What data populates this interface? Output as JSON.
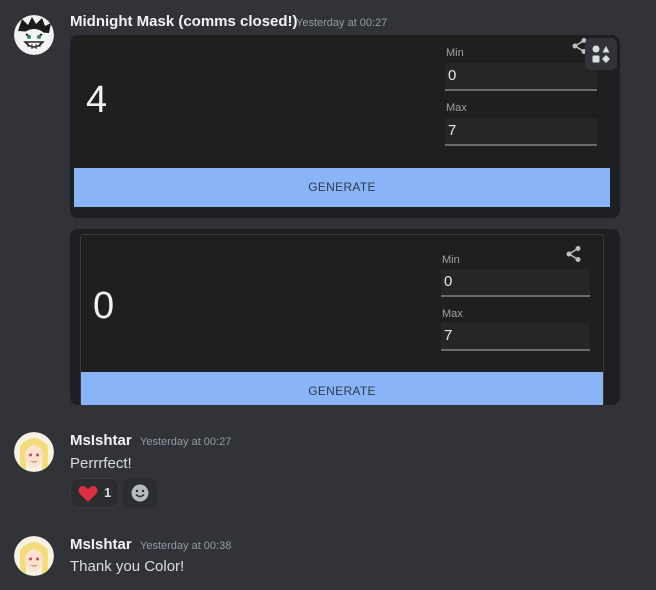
{
  "messages": [
    {
      "username": "Midnight Mask (comms closed!)",
      "timestamp": "Yesterday at 00:27",
      "avatar": "grinning-character-avatar",
      "embeds": [
        {
          "number": "4",
          "min_label": "Min",
          "min_value": "0",
          "max_label": "Max",
          "max_value": "7",
          "button_label": "GENERATE"
        },
        {
          "number": "0",
          "min_label": "Min",
          "min_value": "0",
          "max_label": "Max",
          "max_value": "7",
          "button_label": "GENERATE"
        }
      ]
    },
    {
      "username": "MsIshtar",
      "timestamp": "Yesterday at 00:27",
      "avatar": "blonde-character-avatar",
      "text": "Perrrfect!",
      "reactions": [
        {
          "emoji": "heart-icon",
          "count": "1"
        }
      ]
    },
    {
      "username": "MsIshtar",
      "timestamp": "Yesterday at 00:38",
      "avatar": "blonde-character-avatar",
      "text": "Thank you Color!"
    }
  ],
  "colors": {
    "background": "#313338",
    "embed_bg": "#1f1f1f",
    "button": "#8ab4f8",
    "heart": "#e0245e"
  }
}
